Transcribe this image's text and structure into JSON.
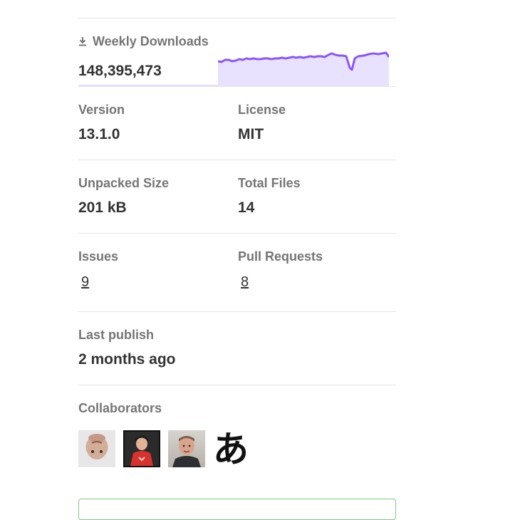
{
  "weekly_downloads": {
    "label": "Weekly Downloads",
    "value": "148,395,473",
    "icon": "download-icon",
    "trend_color": "#8956ff",
    "trend_fill": "#e9e2ff"
  },
  "version": {
    "label": "Version",
    "value": "13.1.0"
  },
  "license": {
    "label": "License",
    "value": "MIT"
  },
  "unpacked_size": {
    "label": "Unpacked Size",
    "value": "201 kB"
  },
  "total_files": {
    "label": "Total Files",
    "value": "14"
  },
  "issues": {
    "label": "Issues",
    "value": "9"
  },
  "pull_requests": {
    "label": "Pull Requests",
    "value": "8"
  },
  "last_publish": {
    "label": "Last publish",
    "value": "2 months ago"
  },
  "collaborators": {
    "label": "Collaborators",
    "avatar_glyph": "あ"
  }
}
